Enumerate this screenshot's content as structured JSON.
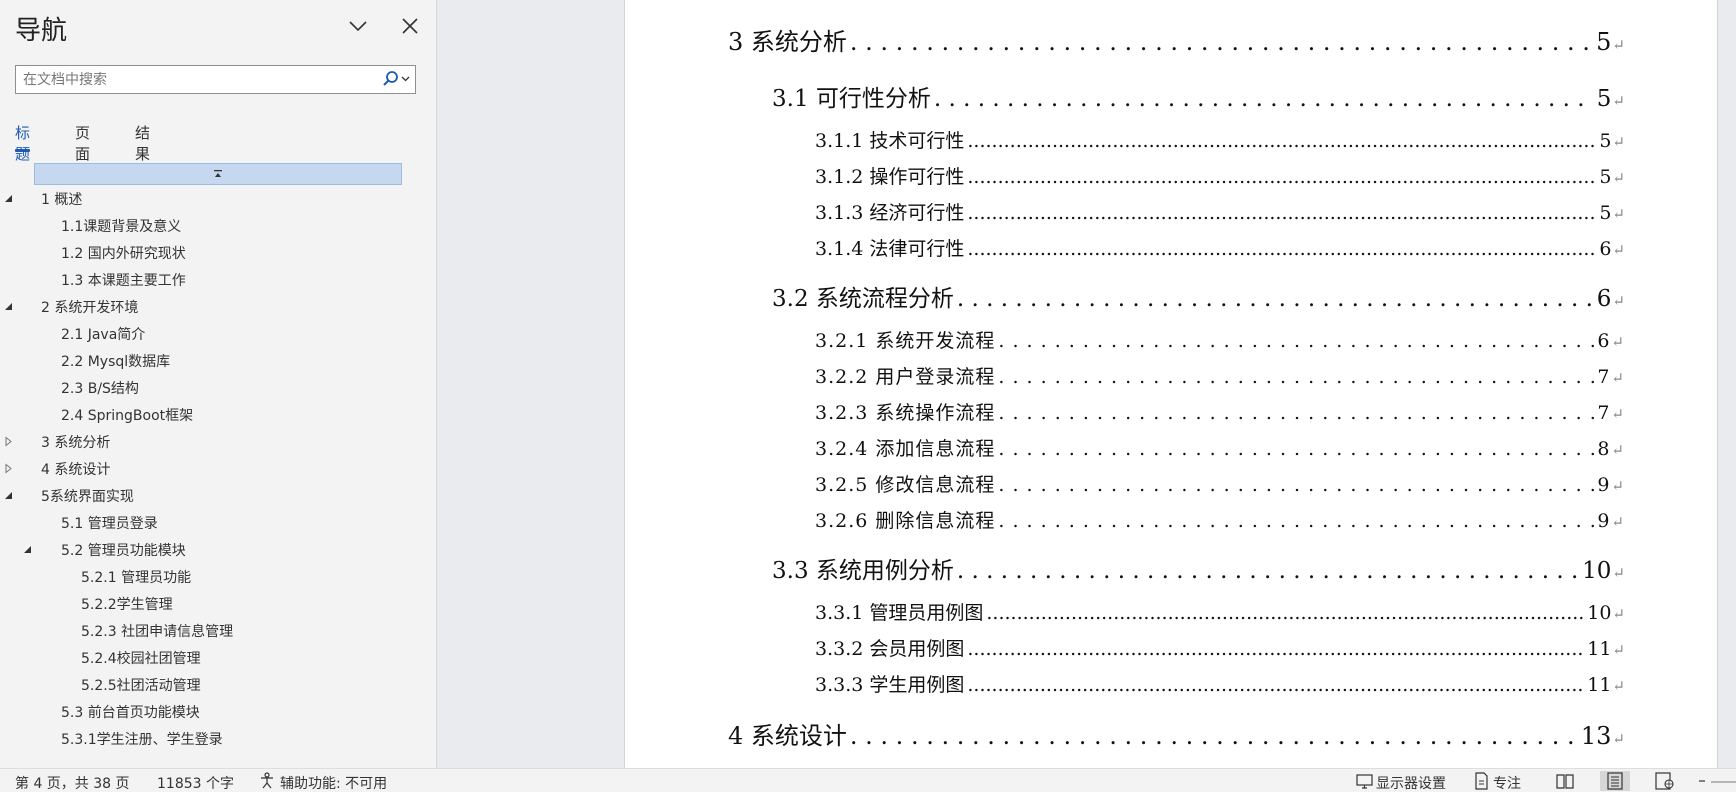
{
  "nav": {
    "title": "导航",
    "search_placeholder": "在文档中搜索",
    "tabs": [
      {
        "label": "标题",
        "active": true
      },
      {
        "label": "页面",
        "active": false
      },
      {
        "label": "结果",
        "active": false
      }
    ],
    "items": [
      {
        "label": "1 概述",
        "level": 1,
        "toggle": "expanded"
      },
      {
        "label": "1.1课题背景及意义",
        "level": 2,
        "toggle": "none"
      },
      {
        "label": "1.2 国内外研究现状",
        "level": 2,
        "toggle": "none"
      },
      {
        "label": "1.3 本课题主要工作",
        "level": 2,
        "toggle": "none"
      },
      {
        "label": "2 系统开发环境",
        "level": 1,
        "toggle": "expanded"
      },
      {
        "label": "2.1 Java简介",
        "level": 2,
        "toggle": "none"
      },
      {
        "label": "2.2 Mysql数据库",
        "level": 2,
        "toggle": "none"
      },
      {
        "label": "2.3 B/S结构",
        "level": 2,
        "toggle": "none"
      },
      {
        "label": "2.4 SpringBoot框架",
        "level": 2,
        "toggle": "none"
      },
      {
        "label": "3 系统分析",
        "level": 1,
        "toggle": "collapsed"
      },
      {
        "label": "4 系统设计",
        "level": 1,
        "toggle": "collapsed"
      },
      {
        "label": "5系统界面实现",
        "level": 1,
        "toggle": "expanded"
      },
      {
        "label": "5.1 管理员登录",
        "level": 2,
        "toggle": "none"
      },
      {
        "label": "5.2  管理员功能模块",
        "level": 2,
        "toggle": "expanded"
      },
      {
        "label": "5.2.1 管理员功能",
        "level": 3,
        "toggle": "none"
      },
      {
        "label": "5.2.2学生管理",
        "level": 3,
        "toggle": "none"
      },
      {
        "label": "5.2.3 社团申请信息管理",
        "level": 3,
        "toggle": "none"
      },
      {
        "label": "5.2.4校园社团管理",
        "level": 3,
        "toggle": "none"
      },
      {
        "label": "5.2.5社团活动管理",
        "level": 3,
        "toggle": "none"
      },
      {
        "label": "5.3 前台首页功能模块",
        "level": 2,
        "toggle": "none"
      },
      {
        "label": "5.3.1学生注册、学生登录",
        "level": 2,
        "toggle": "none"
      }
    ]
  },
  "toc": [
    {
      "title": "3  系统分析",
      "page": "5",
      "style": "lvl1"
    },
    {
      "title": "3.1  可行性分析",
      "page": "5",
      "style": "lvl2"
    },
    {
      "title": "3.1.1  技术可行性",
      "page": "5",
      "style": "lvl3"
    },
    {
      "title": "3.1.2 操作可行性",
      "page": "5",
      "style": "lvl3"
    },
    {
      "title": "3.1.3  经济可行性",
      "page": "5",
      "style": "lvl3"
    },
    {
      "title": "3.1.4  法律可行性",
      "page": "6",
      "style": "lvl3"
    },
    {
      "title": "3.2 系统流程分析",
      "page": "6",
      "style": "lvl2"
    },
    {
      "title": "3.2.1 系统开发流程",
      "page": "6",
      "style": "lvl3b"
    },
    {
      "title": "3.2.2  用户登录流程",
      "page": "7",
      "style": "lvl3b"
    },
    {
      "title": "3.2.3  系统操作流程",
      "page": "7",
      "style": "lvl3b"
    },
    {
      "title": "3.2.4  添加信息流程",
      "page": "8",
      "style": "lvl3b"
    },
    {
      "title": "3.2.5  修改信息流程",
      "page": "9",
      "style": "lvl3b"
    },
    {
      "title": "3.2.6  删除信息流程",
      "page": "9",
      "style": "lvl3b"
    },
    {
      "title": "3.3 系统用例分析",
      "page": "10",
      "style": "lvl2"
    },
    {
      "title": "3.3.1 管理员用例图",
      "page": "10",
      "style": "lvl3"
    },
    {
      "title": "3.3.2 会员用例图",
      "page": "11",
      "style": "lvl3"
    },
    {
      "title": "3.3.3 学生用例图",
      "page": "11",
      "style": "lvl3"
    },
    {
      "title": "4  系统设计",
      "page": "13",
      "style": "lvl1"
    }
  ],
  "status": {
    "page_info": "第 4 页，共 38 页",
    "word_count": "11853 个字",
    "accessibility": "辅助功能: 不可用",
    "display_settings": "显示器设置",
    "focus": "专注"
  }
}
